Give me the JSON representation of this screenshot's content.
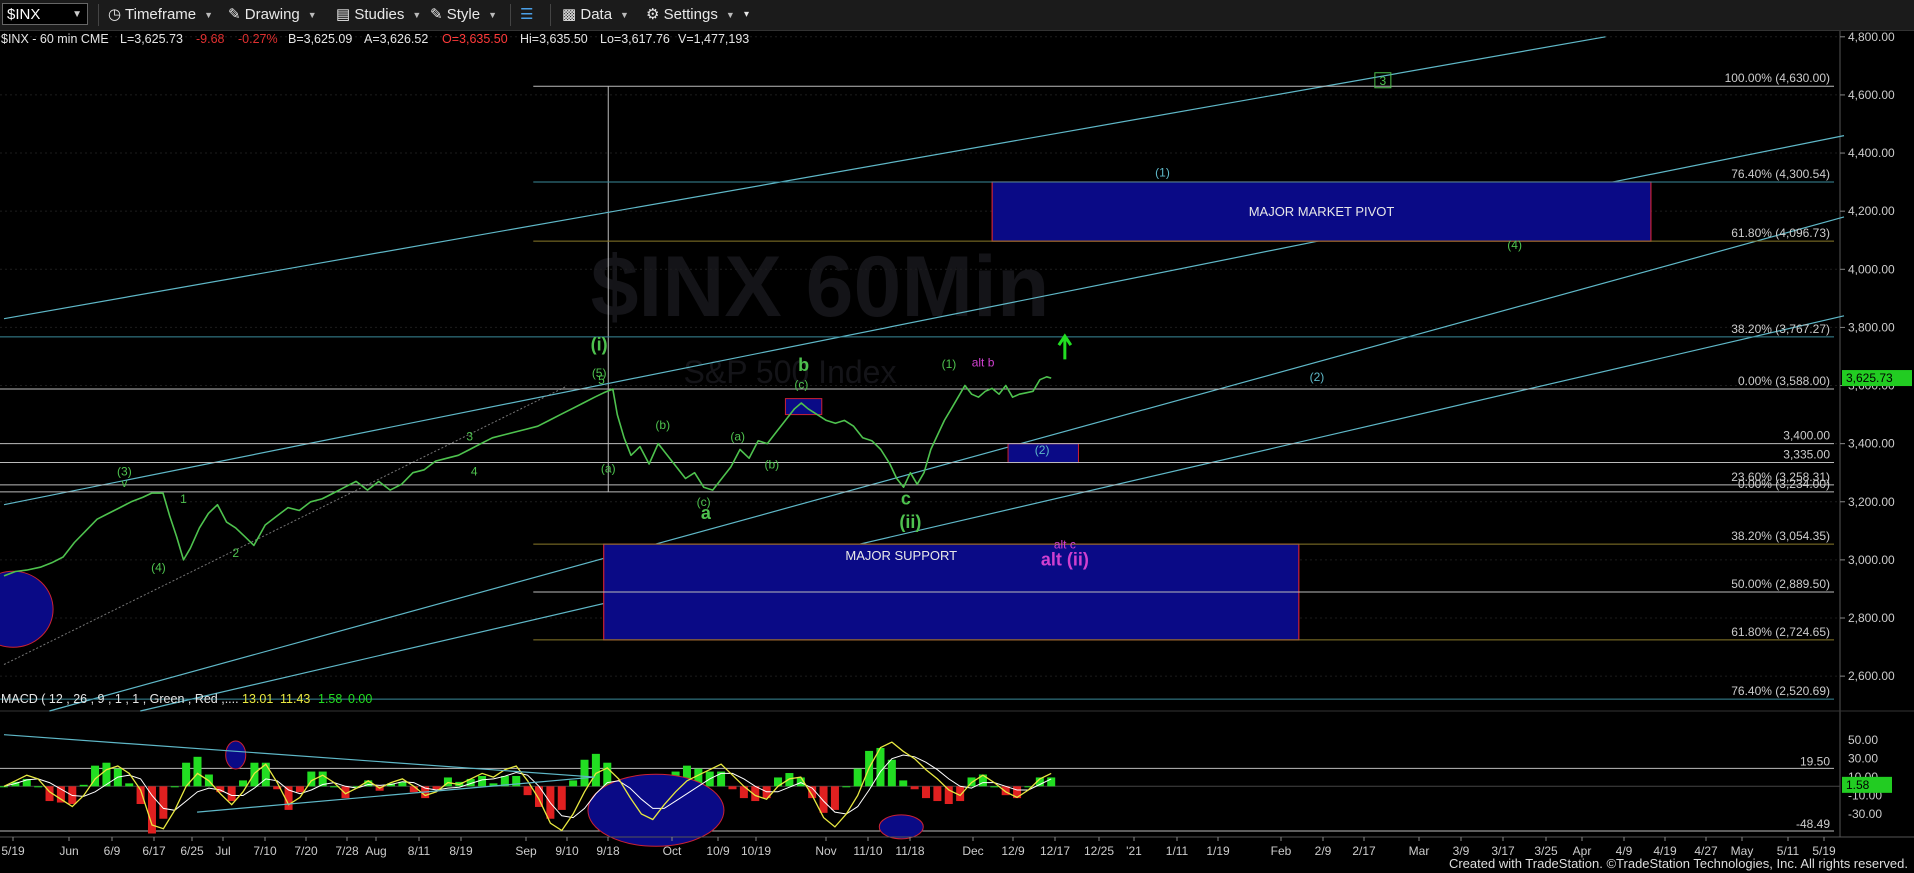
{
  "toolbar": {
    "symbol": "$INX",
    "items": [
      "Timeframe",
      "Drawing",
      "Studies",
      "Style",
      "Data",
      "Settings"
    ]
  },
  "info_bar": {
    "symbol": "$INX - 60 min CME",
    "last": "L=3,625.73",
    "chg": "-9.68",
    "pct": "-0.27%",
    "bid": "B=3,625.09",
    "ask": "A=3,626.52",
    "open": "O=3,635.50",
    "hi": "Hi=3,635.50",
    "lo": "Lo=3,617.76",
    "vol": "V=1,477,193"
  },
  "colors": {
    "wave_green": "#4ec24e",
    "cyan": "#5fb8c8",
    "magenta": "#d040d0",
    "box_fill": "#0a0a86",
    "box_border": "#cc2233",
    "fib_gold": "#8a7a2a"
  },
  "chart_data": [
    {
      "type": "line",
      "title": "$INX - 60 min CME",
      "watermark": "$INX 60Min",
      "watermark_sub": "S&P 500 Index",
      "y_ticks": [
        2600,
        2800,
        3000,
        3200,
        3400,
        3600,
        3800,
        4000,
        4200,
        4400,
        4600,
        4800
      ],
      "y_tick_labels": [
        "2,600.00",
        "2,800.00",
        "3,000.00",
        "3,200.00",
        "3,400.00",
        "3,600.00",
        "3,800.00",
        "4,000.00",
        "4,200.00",
        "4,400.00",
        "4,600.00",
        "4,800.00"
      ],
      "ylim": [
        2480,
        4820
      ],
      "x_labels": [
        "5/19",
        "Jun",
        "6/9",
        "6/17",
        "6/25",
        "Jul",
        "7/10",
        "7/20",
        "7/28",
        "Aug",
        "8/11",
        "8/19",
        "Sep",
        "9/10",
        "9/18",
        "Oct",
        "10/9",
        "10/19",
        "Nov",
        "11/10",
        "11/18",
        "Dec",
        "12/9",
        "12/17",
        "12/25",
        "'21",
        "1/11",
        "1/19",
        "Feb",
        "2/9",
        "2/17",
        "Mar",
        "3/9",
        "3/17",
        "3/25",
        "Apr",
        "4/9",
        "4/19",
        "4/27",
        "May",
        "5/11",
        "5/19"
      ],
      "last_price": 3625.73,
      "last_price_label": "3,625.73",
      "price_path": [
        [
          0,
          2945
        ],
        [
          0.5,
          2960
        ],
        [
          1,
          2965
        ],
        [
          1.6,
          2975
        ],
        [
          2.1,
          2990
        ],
        [
          2.6,
          3010
        ],
        [
          3.1,
          3060
        ],
        [
          3.6,
          3100
        ],
        [
          4.1,
          3140
        ],
        [
          4.6,
          3160
        ],
        [
          5.1,
          3180
        ],
        [
          5.6,
          3200
        ],
        [
          6.1,
          3215
        ],
        [
          6.5,
          3230
        ],
        [
          7,
          3230
        ],
        [
          7.3,
          3150
        ],
        [
          7.6,
          3080
        ],
        [
          7.9,
          3000
        ],
        [
          8.2,
          3040
        ],
        [
          8.6,
          3110
        ],
        [
          9,
          3160
        ],
        [
          9.4,
          3190
        ],
        [
          9.8,
          3130
        ],
        [
          10.2,
          3110
        ],
        [
          10.6,
          3080
        ],
        [
          11,
          3050
        ],
        [
          11.5,
          3120
        ],
        [
          12,
          3150
        ],
        [
          12.5,
          3180
        ],
        [
          13,
          3170
        ],
        [
          13.5,
          3200
        ],
        [
          14,
          3210
        ],
        [
          14.5,
          3230
        ],
        [
          15,
          3250
        ],
        [
          15.5,
          3270
        ],
        [
          16,
          3240
        ],
        [
          16.5,
          3270
        ],
        [
          17,
          3240
        ],
        [
          17.5,
          3260
        ],
        [
          18,
          3300
        ],
        [
          18.5,
          3310
        ],
        [
          19,
          3340
        ],
        [
          19.5,
          3350
        ],
        [
          20,
          3360
        ],
        [
          20.5,
          3380
        ],
        [
          21,
          3400
        ],
        [
          21.5,
          3420
        ],
        [
          22,
          3430
        ],
        [
          22.5,
          3440
        ],
        [
          23,
          3450
        ],
        [
          23.5,
          3460
        ],
        [
          24,
          3480
        ],
        [
          24.5,
          3500
        ],
        [
          25,
          3520
        ],
        [
          25.5,
          3540
        ],
        [
          26,
          3560
        ],
        [
          26.4,
          3575
        ],
        [
          26.8,
          3588
        ],
        [
          27,
          3500
        ],
        [
          27.3,
          3420
        ],
        [
          27.6,
          3360
        ],
        [
          28,
          3390
        ],
        [
          28.4,
          3330
        ],
        [
          28.8,
          3400
        ],
        [
          29.2,
          3360
        ],
        [
          29.6,
          3320
        ],
        [
          30,
          3280
        ],
        [
          30.4,
          3300
        ],
        [
          30.8,
          3250
        ],
        [
          31.2,
          3240
        ],
        [
          31.6,
          3280
        ],
        [
          32,
          3320
        ],
        [
          32.4,
          3380
        ],
        [
          32.8,
          3350
        ],
        [
          33.2,
          3410
        ],
        [
          33.6,
          3400
        ],
        [
          34,
          3440
        ],
        [
          34.4,
          3480
        ],
        [
          34.8,
          3520
        ],
        [
          35.1,
          3540
        ],
        [
          35.4,
          3520
        ],
        [
          35.8,
          3500
        ],
        [
          36.2,
          3480
        ],
        [
          36.6,
          3470
        ],
        [
          37,
          3480
        ],
        [
          37.4,
          3460
        ],
        [
          37.8,
          3420
        ],
        [
          38.2,
          3410
        ],
        [
          38.6,
          3380
        ],
        [
          39,
          3330
        ],
        [
          39.3,
          3280
        ],
        [
          39.6,
          3250
        ],
        [
          39.9,
          3300
        ],
        [
          40.2,
          3260
        ],
        [
          40.5,
          3300
        ],
        [
          40.8,
          3380
        ],
        [
          41.1,
          3430
        ],
        [
          41.4,
          3480
        ],
        [
          41.7,
          3520
        ],
        [
          42,
          3560
        ],
        [
          42.3,
          3600
        ],
        [
          42.6,
          3570
        ],
        [
          42.9,
          3560
        ],
        [
          43.2,
          3580
        ],
        [
          43.5,
          3590
        ],
        [
          43.8,
          3570
        ],
        [
          44.1,
          3600
        ],
        [
          44.4,
          3560
        ],
        [
          44.7,
          3570
        ],
        [
          45,
          3575
        ],
        [
          45.3,
          3580
        ],
        [
          45.6,
          3620
        ],
        [
          45.9,
          3630
        ],
        [
          46.1,
          3625.73
        ]
      ],
      "fib_levels": [
        {
          "label": "100.00% (4,630.00)",
          "value": 4630
        },
        {
          "label": "76.40% (4,300.54)",
          "value": 4300.54
        },
        {
          "label": "61.80% (4,096.73)",
          "value": 4096.73
        },
        {
          "label": "38.20% (3,767.27)",
          "value": 3767.27
        },
        {
          "label": "0.00% (3,588.00)",
          "value": 3588
        },
        {
          "label": "3,400.00",
          "value": 3400
        },
        {
          "label": "3,335.00",
          "value": 3335
        },
        {
          "label": "23.60% (3,258.31)",
          "value": 3258.31
        },
        {
          "label": "0.00% (3,234.00)",
          "value": 3234
        },
        {
          "label": "38.20% (3,054.35)",
          "value": 3054.35
        },
        {
          "label": "50.00% (2,889.50)",
          "value": 2889.5
        },
        {
          "label": "61.80% (2,724.65)",
          "value": 2724.65
        },
        {
          "label": "76.40% (2,520.69)",
          "value": 2520.69
        }
      ],
      "boxes": [
        {
          "label": "MAJOR MARKET PIVOT",
          "x0": 43.5,
          "x1": 72.5,
          "y0": 4096.73,
          "y1": 4300.54
        },
        {
          "label": "MAJOR SUPPORT",
          "x0": 26.4,
          "x1": 57,
          "y0": 2724.65,
          "y1": 3054.35
        }
      ],
      "wave_labels": [
        {
          "text": "(i)",
          "x": 26.2,
          "y": 3720,
          "color": "green",
          "big": true
        },
        {
          "text": "(5)",
          "x": 26.2,
          "y": 3630,
          "color": "green"
        },
        {
          "text": "5",
          "x": 26.3,
          "y": 3605,
          "color": "green"
        },
        {
          "text": "(3)",
          "x": 5.3,
          "y": 3290,
          "color": "green"
        },
        {
          "text": "v",
          "x": 5.3,
          "y": 3250,
          "color": "green"
        },
        {
          "text": "1",
          "x": 7.9,
          "y": 3195,
          "color": "green"
        },
        {
          "text": "(4)",
          "x": 6.8,
          "y": 2960,
          "color": "green"
        },
        {
          "text": "2",
          "x": 10.2,
          "y": 3010,
          "color": "green"
        },
        {
          "text": "3",
          "x": 20.5,
          "y": 3410,
          "color": "green"
        },
        {
          "text": "4",
          "x": 20.7,
          "y": 3290,
          "color": "green"
        },
        {
          "text": "(a)",
          "x": 26.6,
          "y": 3300,
          "color": "green"
        },
        {
          "text": "(b)",
          "x": 29,
          "y": 3450,
          "color": "green"
        },
        {
          "text": "(c)",
          "x": 30.8,
          "y": 3185,
          "color": "green"
        },
        {
          "text": "a",
          "x": 30.9,
          "y": 3140,
          "color": "green",
          "big": true
        },
        {
          "text": "(a)",
          "x": 32.3,
          "y": 3410,
          "color": "green"
        },
        {
          "text": "(b)",
          "x": 33.8,
          "y": 3315,
          "color": "green"
        },
        {
          "text": "(c)",
          "x": 35.1,
          "y": 3590,
          "color": "green"
        },
        {
          "text": "b",
          "x": 35.2,
          "y": 3650,
          "color": "green",
          "big": true
        },
        {
          "text": "c",
          "x": 39.7,
          "y": 3190,
          "color": "green",
          "big": true
        },
        {
          "text": "(ii)",
          "x": 39.9,
          "y": 3110,
          "color": "green",
          "big": true
        },
        {
          "text": "(1)",
          "x": 41.6,
          "y": 3660,
          "color": "green"
        },
        {
          "text": "alt b",
          "x": 43.1,
          "y": 3665,
          "color": "magenta"
        },
        {
          "text": "(2)",
          "x": 45.7,
          "y": 3365,
          "color": "cyan"
        },
        {
          "text": "alt c",
          "x": 46.7,
          "y": 3040,
          "color": "magenta"
        },
        {
          "text": "alt (ii)",
          "x": 46.7,
          "y": 2980,
          "color": "magenta",
          "big": true
        },
        {
          "text": "(1)",
          "x": 51,
          "y": 4320,
          "color": "cyan"
        },
        {
          "text": "(2)",
          "x": 57.8,
          "y": 3615,
          "color": "cyan"
        },
        {
          "text": "(4)",
          "x": 66.5,
          "y": 4070,
          "color": "green"
        },
        {
          "text": "3",
          "x": 60.7,
          "y": 4635,
          "color": "green",
          "boxed": true
        }
      ]
    },
    {
      "type": "line",
      "title": "MACD ( 12 , 26 , 9 , 1 , 1 , Green , Red ,....",
      "legend_values": [
        "13.01",
        "11.43",
        "1.58",
        "0.00"
      ],
      "y_tick_labels": [
        "50.00",
        "30.00",
        "10.00",
        "-10.00",
        "-30.00"
      ],
      "ylim": [
        -55,
        60
      ],
      "ref_levels": [
        {
          "label": "19.50",
          "value": 19.5
        },
        {
          "label": "-48.49",
          "value": -48.49
        }
      ],
      "last_value_label": "1.58",
      "macd": [
        0,
        6,
        12,
        8,
        -6,
        -14,
        -22,
        -10,
        8,
        18,
        22,
        14,
        -4,
        -42,
        -46,
        -26,
        0,
        14,
        6,
        -8,
        -20,
        -6,
        14,
        24,
        4,
        -20,
        -12,
        6,
        12,
        4,
        -8,
        -2,
        6,
        -2,
        4,
        8,
        0,
        -10,
        -6,
        4,
        2,
        8,
        14,
        10,
        18,
        22,
        6,
        -14,
        -40,
        -48,
        -30,
        -6,
        14,
        20,
        8,
        -12,
        -30,
        -36,
        -20,
        -6,
        6,
        12,
        18,
        24,
        12,
        0,
        -10,
        -14,
        0,
        8,
        10,
        -10,
        -34,
        -44,
        -30,
        -10,
        20,
        42,
        48,
        38,
        30,
        18,
        8,
        -4,
        -10,
        4,
        12,
        4,
        -6,
        -12,
        -4,
        8,
        14
      ],
      "signal": [
        0,
        3,
        7,
        8,
        4,
        -3,
        -10,
        -11,
        -6,
        2,
        10,
        12,
        8,
        -10,
        -24,
        -26,
        -16,
        -6,
        -2,
        -4,
        -10,
        -10,
        -2,
        8,
        6,
        -4,
        -8,
        -4,
        2,
        4,
        0,
        -2,
        2,
        1,
        2,
        5,
        4,
        -2,
        -4,
        -2,
        -1,
        3,
        7,
        8,
        11,
        15,
        12,
        0,
        -18,
        -32,
        -34,
        -24,
        -8,
        4,
        6,
        -2,
        -14,
        -24,
        -24,
        -16,
        -8,
        0,
        8,
        14,
        14,
        8,
        0,
        -6,
        -6,
        -1,
        4,
        -2,
        -16,
        -28,
        -30,
        -22,
        -4,
        16,
        30,
        34,
        32,
        26,
        18,
        8,
        0,
        -2,
        4,
        4,
        0,
        -4,
        -4,
        2,
        8
      ]
    }
  ],
  "footer": "Created with TradeStation. ©TradeStation Technologies, Inc. All rights reserved."
}
